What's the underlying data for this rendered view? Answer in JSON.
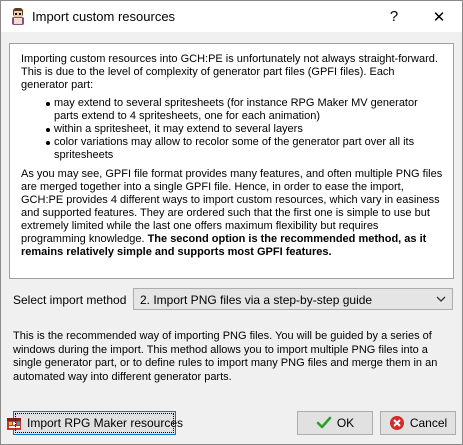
{
  "window": {
    "title": "Import custom resources",
    "help_glyph": "?",
    "close_glyph": "✕",
    "icon": "app-character-icon"
  },
  "info": {
    "intro": "Importing custom resources into GCH:PE is unfortunately not always straight-forward. This is due to the level of complexity of generator part files (GPFI files). Each generator part:",
    "bullets": [
      "may extend to several spritesheets (for instance RPG Maker MV generator parts extend to 4 spritesheets, one for each animation)",
      "within a spritesheet, it may extend to several layers",
      "color variations may allow to recolor some of the generator part over all its spritesheets"
    ],
    "outro": "As you may see, GPFI file format provides many features, and often multiple PNG files are merged together into a single GPFI file. Hence, in order to ease the import, GCH:PE provides 4 different ways to import custom resources, which vary in easiness and supported features. They are ordered such that the first one is simple to use but extremely limited while the last one offers maximum flexibility but requires programming knowledge.",
    "outro_bold": "The second option is the recommended method, as it remains relatively simple and supports most GPFI features."
  },
  "import_method": {
    "label": "Select import method",
    "selected": "2. Import PNG files via a step-by-step guide"
  },
  "description": "This is the recommended way of importing PNG files. You will be guided by a series of windows during the import. This method allows you to import multiple PNG files into a single generator part, or to define rules to import many PNG files and merge them in an automated way into different generator parts.",
  "buttons": {
    "rpg_label": "Import RPG Maker resources",
    "ok_label": "OK",
    "cancel_label": "Cancel"
  },
  "colors": {
    "ok_check": "#2e9e2e",
    "cancel_red": "#d42a2a",
    "focus_border": "#0078d7"
  }
}
